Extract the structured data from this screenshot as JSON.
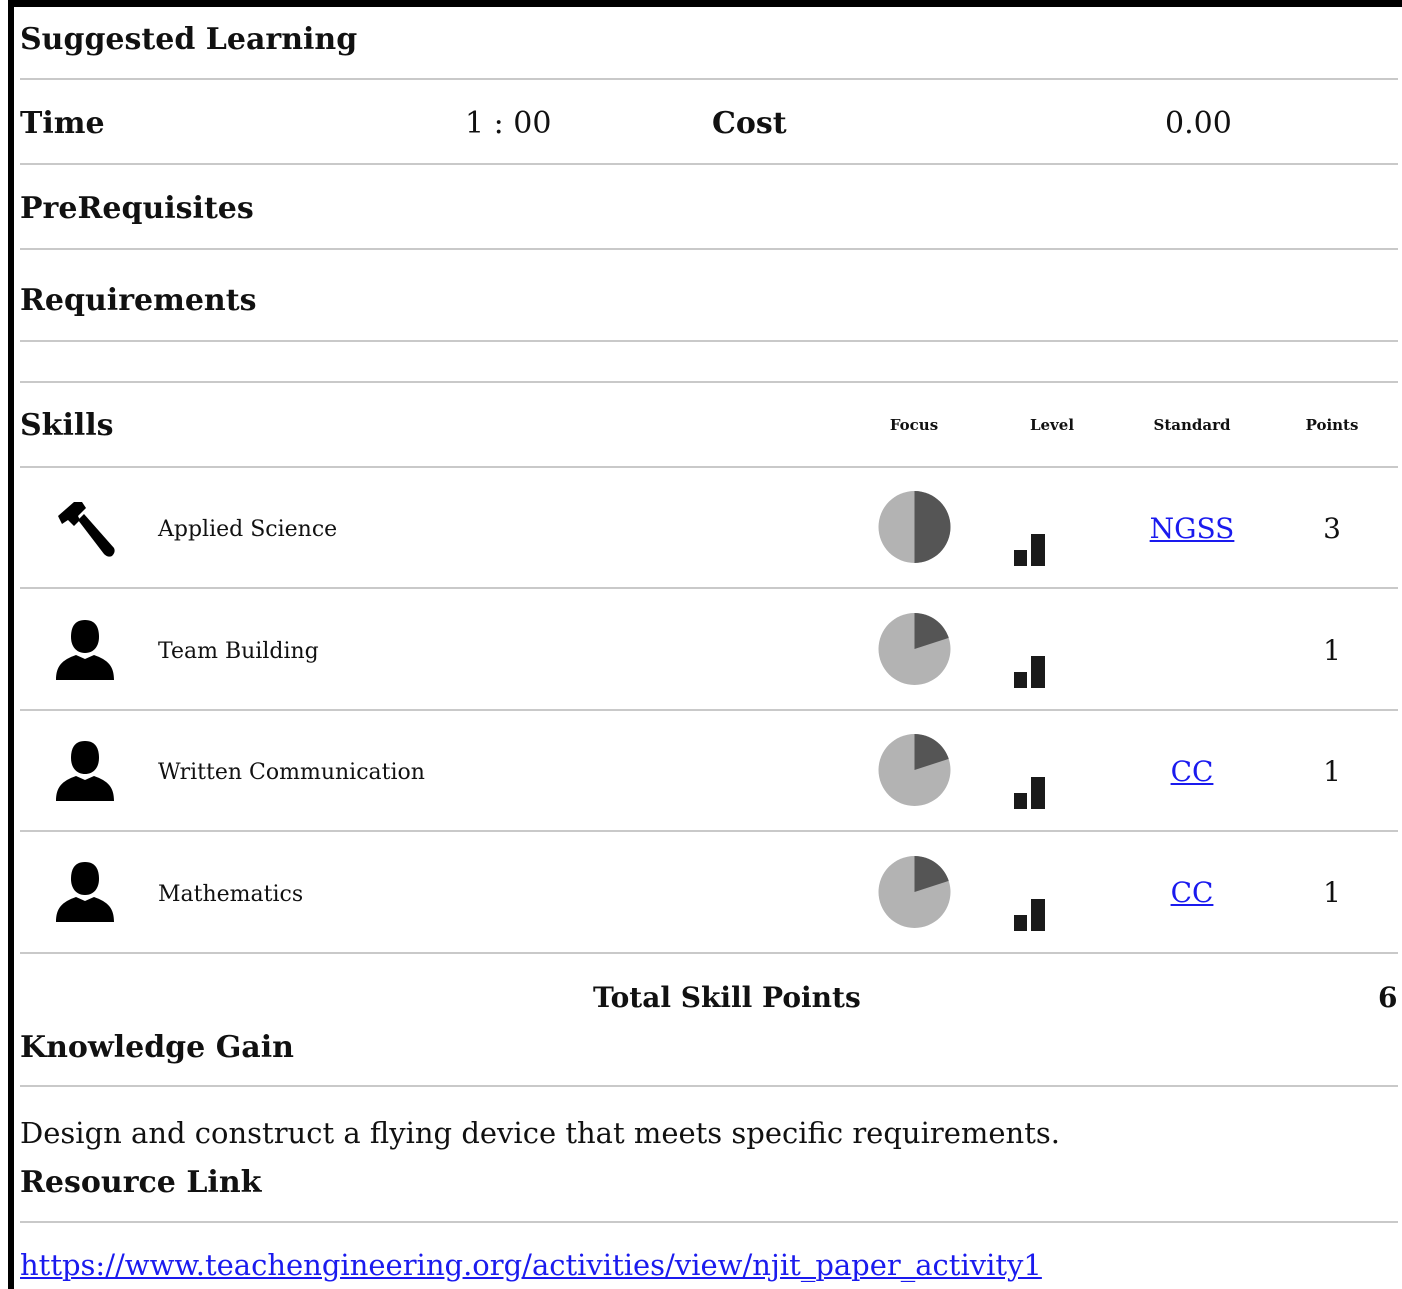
{
  "section_titles": {
    "suggested_learning": "Suggested Learning",
    "prerequisites": "PreRequisites",
    "requirements": "Requirements",
    "skills": "Skills",
    "knowledge_gain": "Knowledge Gain",
    "resource_link": "Resource Link"
  },
  "time": {
    "label": "Time",
    "value": "1 : 00"
  },
  "cost": {
    "label": "Cost",
    "value": "0.00"
  },
  "skills_table": {
    "columns": [
      "Focus",
      "Level",
      "Standard",
      "Points"
    ],
    "rows": [
      {
        "icon": "hammer-icon",
        "name": "Applied Science",
        "focus_fraction": 0.5,
        "standard": "NGSS",
        "points": "3"
      },
      {
        "icon": "person-icon",
        "name": "Team Building",
        "focus_fraction": 0.2,
        "standard": "",
        "points": "1"
      },
      {
        "icon": "person-icon",
        "name": "Written Communication",
        "focus_fraction": 0.2,
        "standard": "CC",
        "points": "1"
      },
      {
        "icon": "person-icon",
        "name": "Mathematics",
        "focus_fraction": 0.2,
        "standard": "CC",
        "points": "1"
      }
    ]
  },
  "total": {
    "label": "Total Skill Points",
    "value": "6"
  },
  "knowledge_gain_text": "Design and construct a flying device that meets specific requirements.",
  "resource_url": "https://www.teachengineering.org/activities/view/njit_paper_activity1",
  "colors": {
    "pie_dark": "#555555",
    "pie_light": "#b3b3b3",
    "link": "#1a1aee",
    "rule": "#c9c9c9"
  }
}
